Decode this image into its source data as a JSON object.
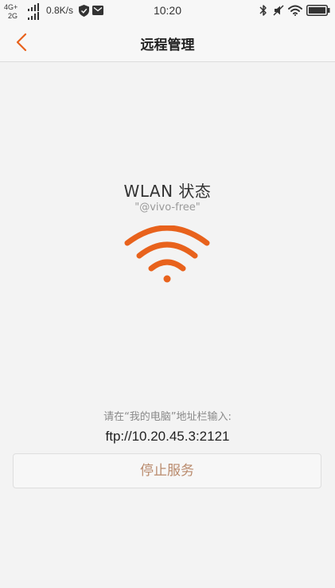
{
  "status_bar": {
    "network_top": "4G+",
    "network_bottom": "2G",
    "speed": "0.8K/s",
    "time": "10:20",
    "icons": [
      "signal-icon",
      "shield-icon",
      "mail-icon",
      "bluetooth-icon",
      "mute-icon",
      "wifi-icon",
      "battery-icon"
    ]
  },
  "header": {
    "title": "远程管理",
    "back_icon": "chevron-left-icon"
  },
  "main": {
    "wlan_title": "WLAN 状态",
    "ssid": "\"@vivo-free\"",
    "wifi_icon": "wifi-icon",
    "hint": "请在“我的电脑”地址栏输入:",
    "ftp_address": "ftp://10.20.45.3:2121",
    "stop_button_label": "停止服务"
  },
  "colors": {
    "accent": "#e8621c",
    "button_text": "#b98a6c",
    "background": "#f3f3f3",
    "bar_background": "#f7f7f7"
  }
}
